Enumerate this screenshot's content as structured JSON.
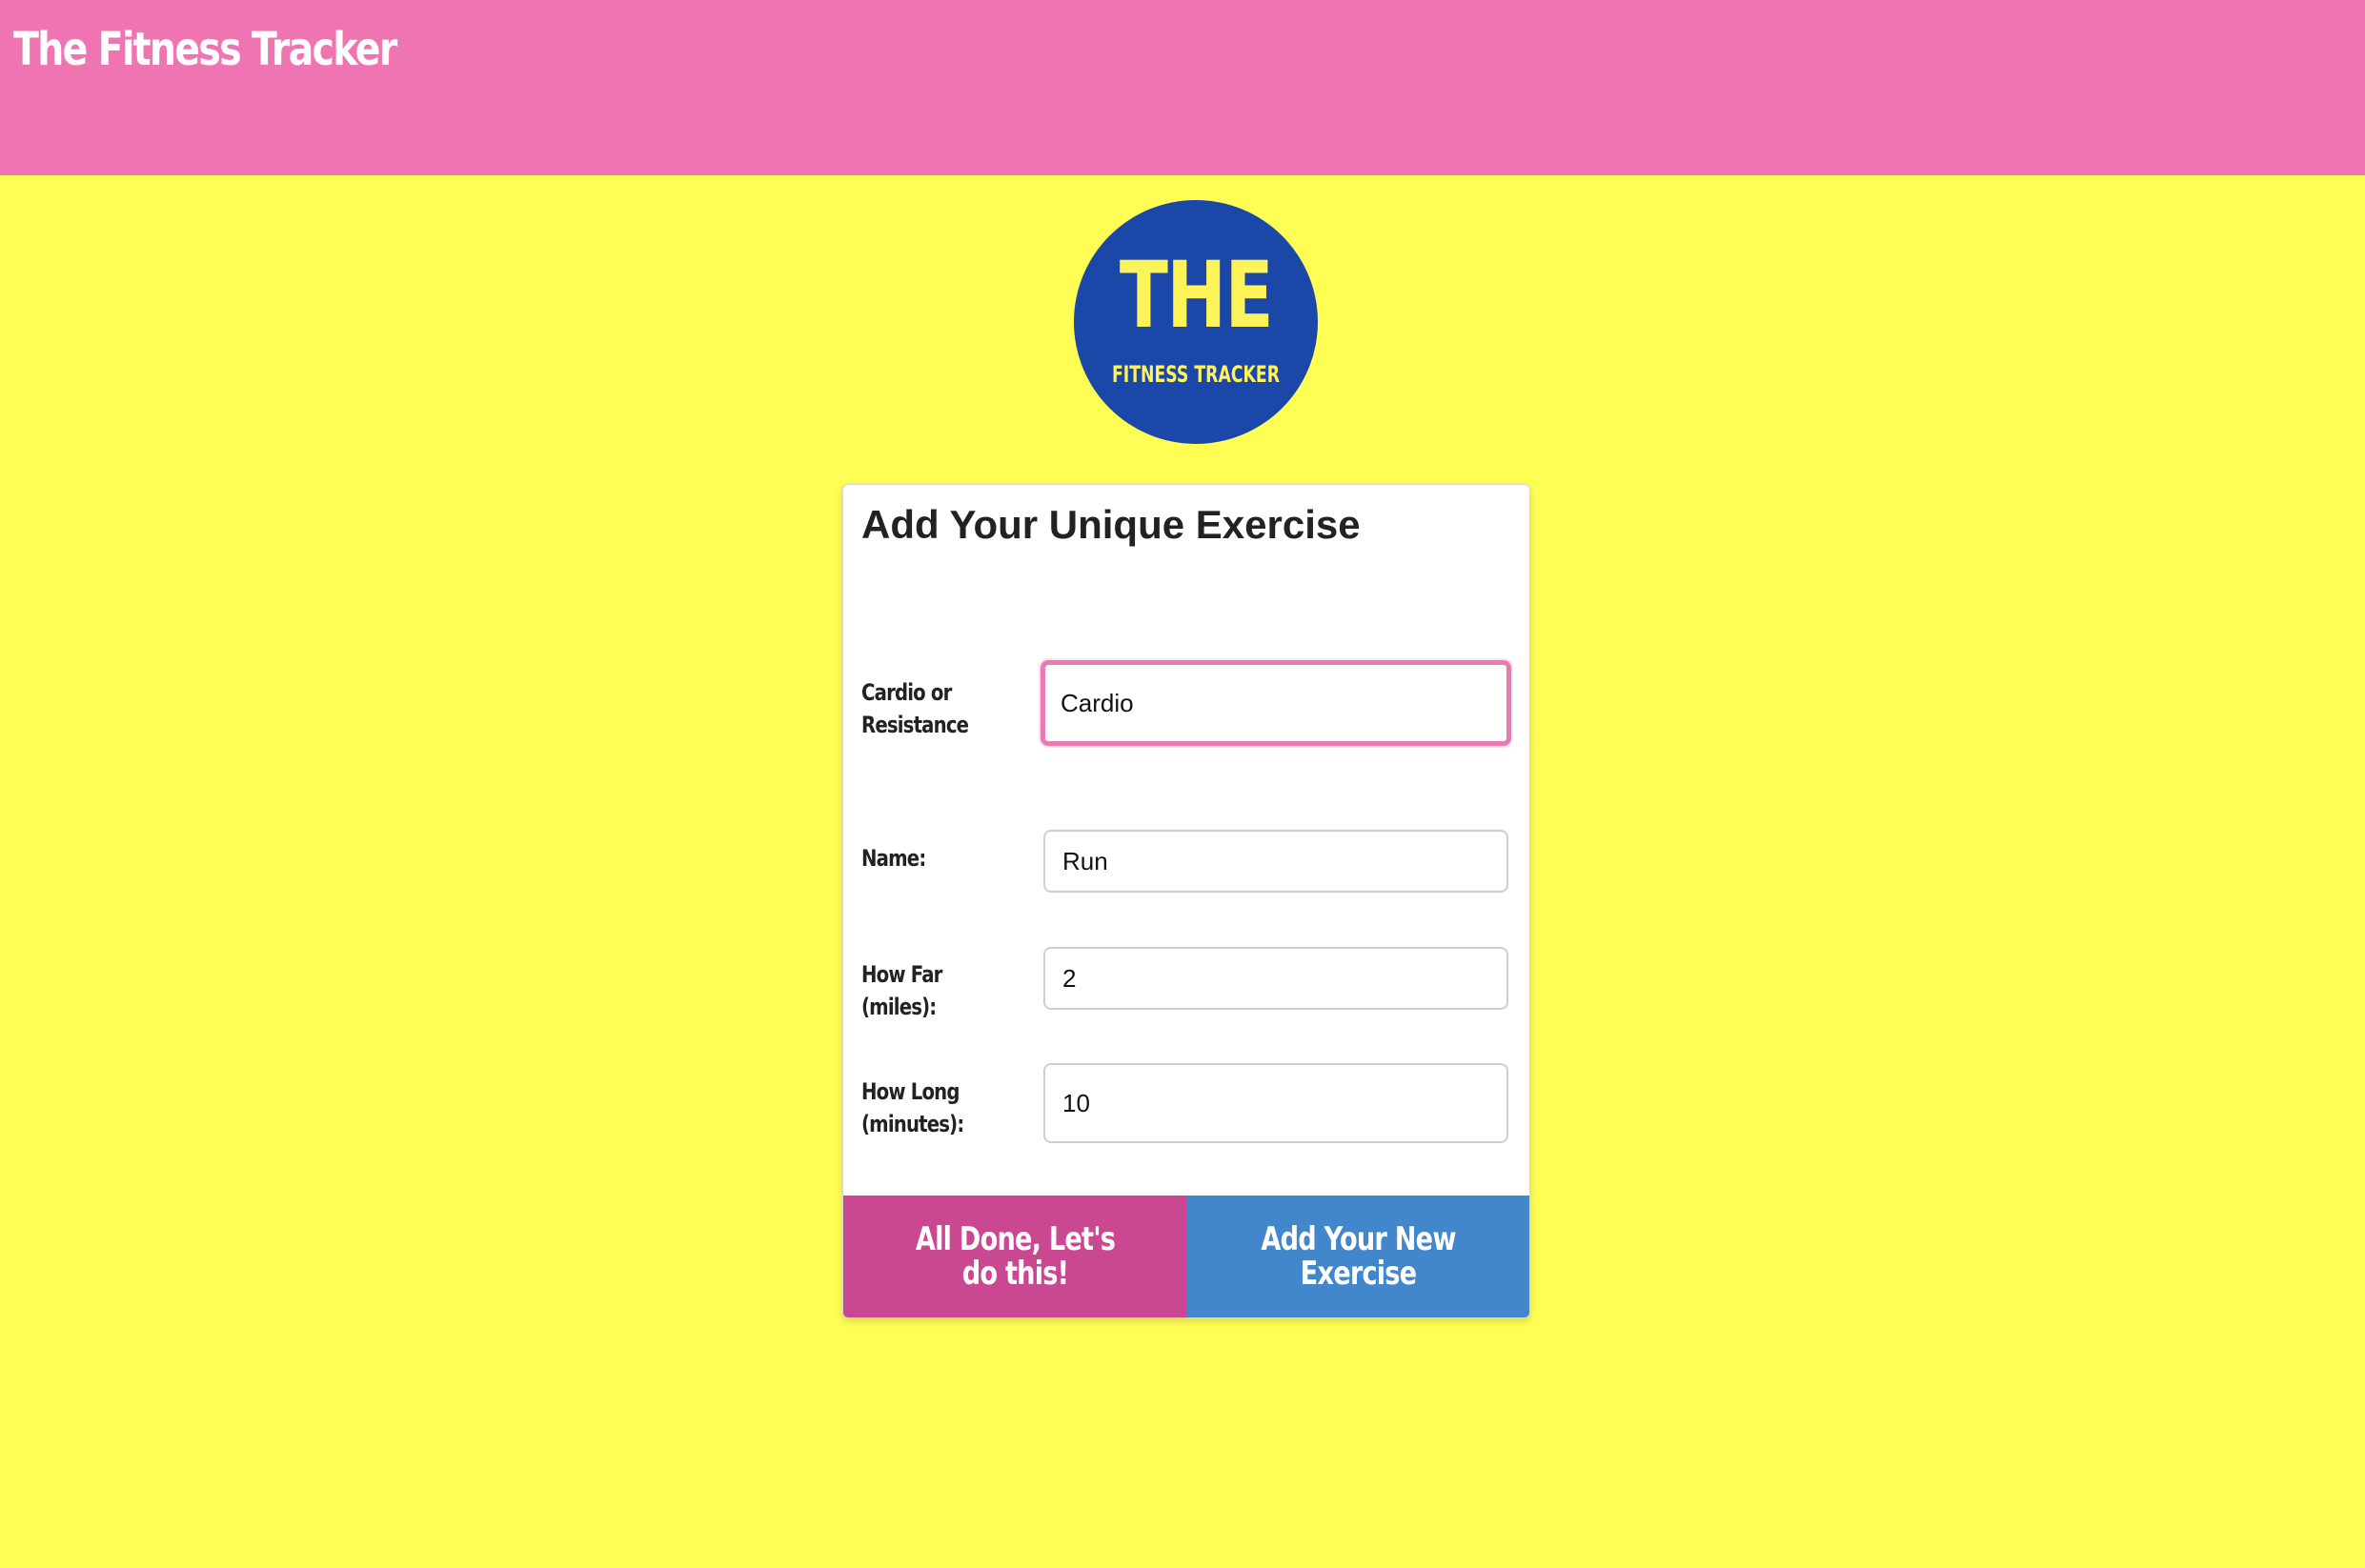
{
  "header": {
    "title": "The Fitness Tracker"
  },
  "logo": {
    "big_text": "THE",
    "small_text": "FITNESS TRACKER"
  },
  "form": {
    "title": "Add Your Unique Exercise",
    "fields": [
      {
        "label": "Cardio or Resistance",
        "value": "Cardio",
        "focused": true
      },
      {
        "label": "Name:",
        "value": "Run"
      },
      {
        "label": "How Far (miles):",
        "value": "2"
      },
      {
        "label": "How Long (minutes):",
        "value": "10"
      }
    ],
    "buttons": {
      "done_label": "All Done, Let's do this!",
      "add_label": "Add Your New Exercise"
    }
  },
  "colors": {
    "header_bg": "#ee74b2",
    "page_bg": "#fffe55",
    "logo_bg": "#1b47a8",
    "logo_text": "#fff35a",
    "done_button": "#ca4792",
    "add_button": "#4287cb",
    "focus_ring": "#e97ab4"
  }
}
